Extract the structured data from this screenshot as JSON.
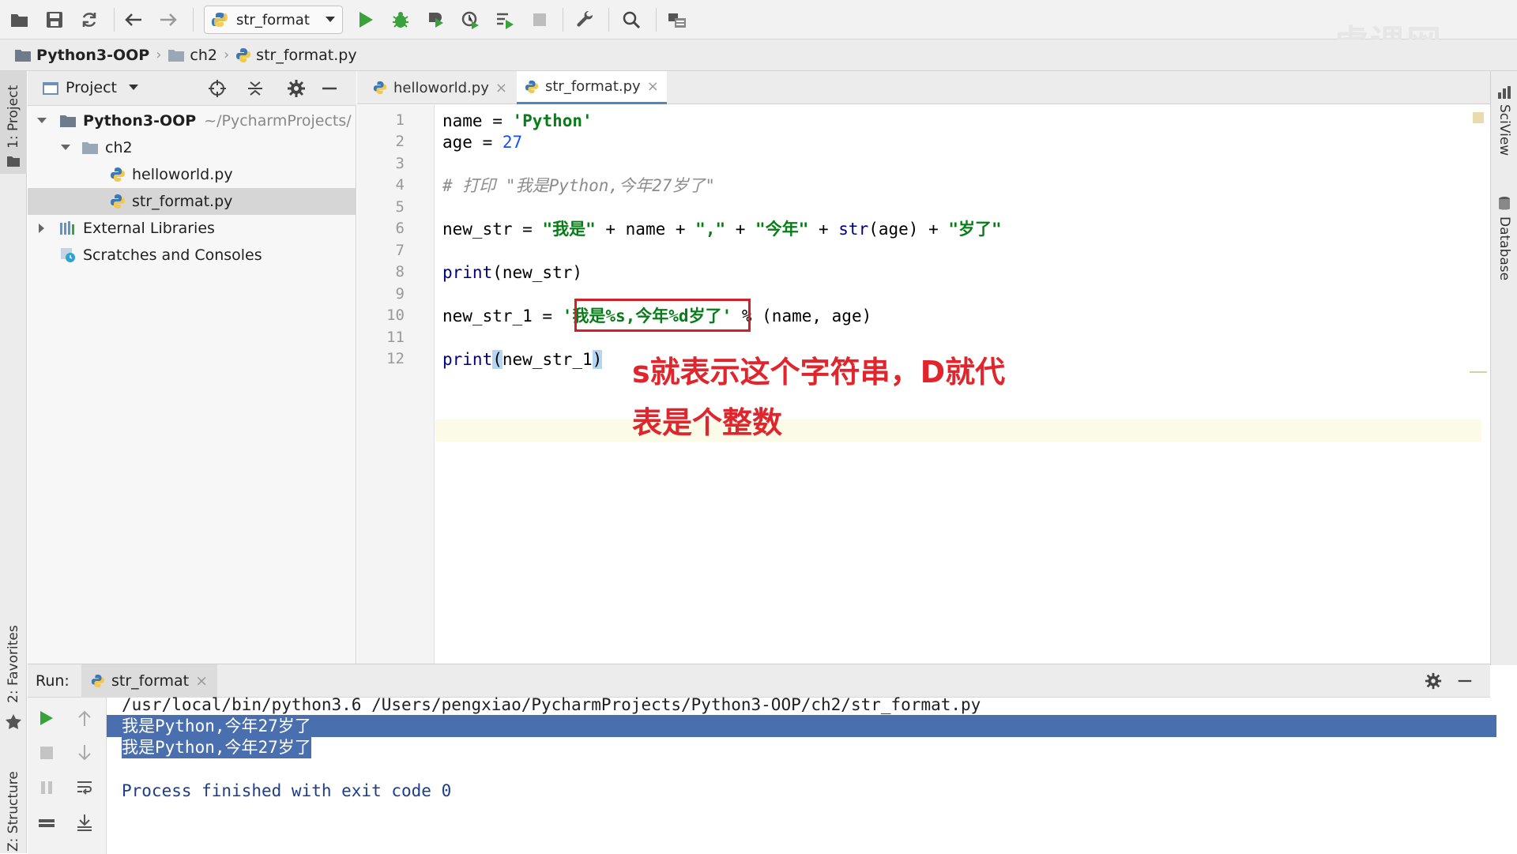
{
  "toolbar": {
    "run_config": "str_format",
    "icons": [
      "open-icon",
      "save-icon",
      "sync-icon",
      "back-icon",
      "forward-icon",
      "python-icon",
      "run-icon",
      "debug-icon",
      "coverage-icon",
      "profile-icon",
      "concurrency-icon",
      "stop-icon",
      "wrench-icon",
      "search-icon",
      "structure-icon"
    ]
  },
  "watermark": "虎课网",
  "breadcrumb": {
    "project": "Python3-OOP",
    "folder": "ch2",
    "file": "str_format.py"
  },
  "left_strip": {
    "project_tab": "1: Project",
    "favorites_tab": "2: Favorites",
    "structure_tab": "Z: Structure"
  },
  "right_strip": {
    "sciview_tab": "SciView",
    "database_tab": "Database"
  },
  "project_panel": {
    "title": "Project",
    "tree": {
      "root_label": "Python3-OOP",
      "root_path": "~/PycharmProjects/",
      "folder": "ch2",
      "file1": "helloworld.py",
      "file2": "str_format.py",
      "ext_libs": "External Libraries",
      "scratches": "Scratches and Consoles"
    }
  },
  "editor": {
    "tabs": [
      {
        "label": "helloworld.py",
        "close": "×"
      },
      {
        "label": "str_format.py",
        "close": "×"
      }
    ],
    "line_numbers": [
      "1",
      "2",
      "3",
      "4",
      "5",
      "6",
      "7",
      "8",
      "9",
      "10",
      "11",
      "12"
    ],
    "code": {
      "l1": {
        "a": "name = ",
        "b": "'Python'"
      },
      "l2": {
        "a": "age = ",
        "b": "27"
      },
      "l4": "# 打印 \"我是Python,今年27岁了\"",
      "l6": {
        "a": "new_str = ",
        "s1": "\"我是\"",
        "b": " + name + ",
        "s2": "\",\"",
        "c": " + ",
        "s3": "\"今年\"",
        "d": " + ",
        "fn": "str",
        "e": "(age) + ",
        "s4": "\"岁了\""
      },
      "l8": {
        "fn": "print",
        "rest": "(new_str)"
      },
      "l10": {
        "a": "new_str_1 = ",
        "s": "'我是%s,今年%d岁了'",
        "b": " % (name, age)"
      },
      "l12": {
        "fn": "print",
        "p1": "(",
        "arg": "new_str_1",
        "p2": ")"
      }
    },
    "annotation": {
      "line1": "s就表示这个字符串，D就代",
      "line2": "表是个整数"
    }
  },
  "run_panel": {
    "label": "Run:",
    "tab": "str_format",
    "tab_close": "×",
    "output": {
      "cmd": "/usr/local/bin/python3.6 /Users/pengxiao/PycharmProjects/Python3-OOP/ch2/str_format.py",
      "out1": "我是Python,今年27岁了",
      "out2": "我是Python,今年27岁了",
      "exit": "Process finished with exit code 0"
    }
  }
}
